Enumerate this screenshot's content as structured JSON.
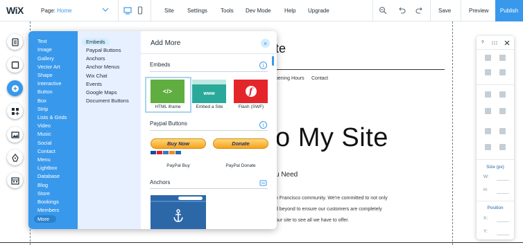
{
  "topbar": {
    "logo": "WiX",
    "page_label": "Page:",
    "page_value": "Home",
    "menu": [
      "Site",
      "Settings",
      "Tools",
      "Dev Mode",
      "Help",
      "Upgrade"
    ],
    "save": "Save",
    "preview": "Preview",
    "publish": "Publish"
  },
  "site": {
    "title_fragment": "te",
    "nav": [
      "pening Hours",
      "Contact"
    ],
    "hero": "o My Site",
    "subheading": "u Need",
    "body_lines": [
      "n Francisco community. We're committed to not only",
      "d beyond to ensure our customers are completely",
      "our site to see all we have to offer."
    ]
  },
  "left_rail": [
    "pages-icon",
    "background-icon",
    "add-icon",
    "apps-icon",
    "media-icon",
    "blog-icon",
    "bookings-icon"
  ],
  "add_panel": {
    "categories": [
      "Text",
      "Image",
      "Gallery",
      "Vector Art",
      "Shape",
      "Interactive",
      "Button",
      "Box",
      "Strip",
      "Lists & Grids",
      "Video",
      "Music",
      "Social",
      "Contact",
      "Menu",
      "Lightbox",
      "Database",
      "Blog",
      "Store",
      "Bookings",
      "Members"
    ],
    "more": "More",
    "subcategories": [
      "Embeds",
      "Paypal Buttons",
      "Anchors",
      "Anchor Menus",
      "Wix Chat",
      "Events",
      "Google Maps",
      "Document Buttons"
    ],
    "title": "Add More",
    "close": "×",
    "sections": {
      "embeds": "Embeds",
      "paypal": "Paypal Buttons",
      "anchors": "Anchors"
    },
    "embed_tiles": [
      {
        "label": "HTML iframe",
        "glyph": "</>",
        "color": "#5fae3f"
      },
      {
        "label": "Embed a Site",
        "glyph": "www",
        "color": "#2aa99b"
      },
      {
        "label": "Flash (SWF)",
        "glyph": "f",
        "color": "#e4262b"
      }
    ],
    "paypal_buy": {
      "button": "Buy Now",
      "label": "PayPal Buy"
    },
    "paypal_donate": {
      "button": "Donate",
      "label": "PayPal Donate"
    },
    "info": "i"
  },
  "tools_panel": {
    "help": "?",
    "size_label": "Size (px)",
    "w": "W:",
    "h": "H:",
    "position_label": "Position",
    "x": "X:",
    "y": "Y:"
  },
  "colors": {
    "accent": "#3899ec",
    "category_bg": "#3899ec",
    "subcategory_bg": "#e7f0ff"
  }
}
